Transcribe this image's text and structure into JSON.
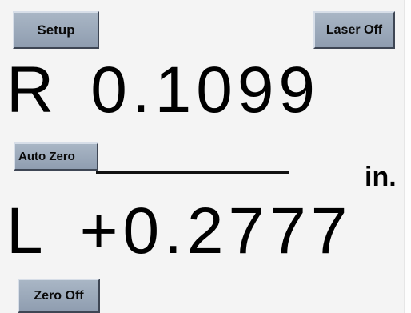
{
  "buttons": {
    "setup": "Setup",
    "laser_off": "Laser Off",
    "auto_zero": "Auto Zero",
    "zero_off": "Zero Off"
  },
  "readings": {
    "right": {
      "side": "R",
      "value": "0.1099"
    },
    "left": {
      "side": "L",
      "value": "+0.2777"
    }
  },
  "unit": "in.",
  "colors": {
    "background": "#f4f4f4",
    "button_face": "#9aa7b8",
    "text": "#000000"
  }
}
